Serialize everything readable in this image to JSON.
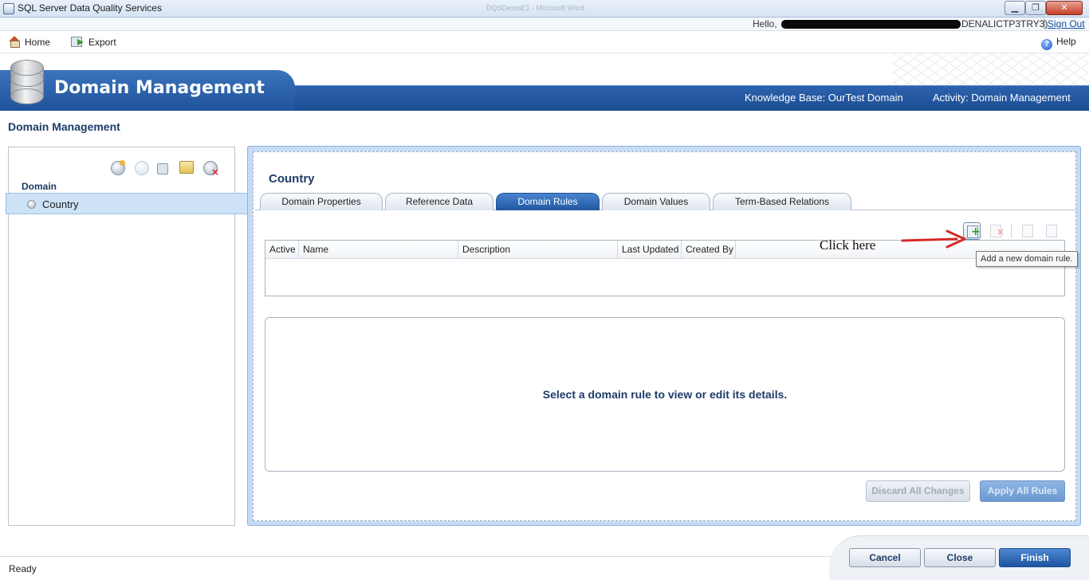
{
  "window": {
    "title": "SQL Server Data Quality Services",
    "faint_title": "DQSDemoE1 - Microsoft Word",
    "minimize_glyph": "▁",
    "maximize_glyph": "❐",
    "close_glyph": "✕"
  },
  "userbar": {
    "hello": "Hello,",
    "user_suffix": "DENALICTP3TRY3)",
    "separator": "|",
    "sign_out": "Sign Out"
  },
  "menu": {
    "home": "Home",
    "export": "Export",
    "help": "Help",
    "help_glyph": "?"
  },
  "banner": {
    "title": "Domain Management",
    "knowledge_base": "Knowledge Base: OurTest Domain",
    "activity": "Activity: Domain Management"
  },
  "page": {
    "title": "Domain Management"
  },
  "left_panel": {
    "section_label": "Domain",
    "domains": [
      "Country"
    ]
  },
  "right_panel": {
    "title": "Country",
    "tabs": [
      "Domain Properties",
      "Reference Data",
      "Domain Rules",
      "Domain Values",
      "Term-Based Relations"
    ],
    "active_tab": "Domain Rules",
    "grid_columns": [
      "Active",
      "Name",
      "Description",
      "Last Updated",
      "Created By"
    ],
    "detail_message": "Select a domain rule to view or edit its details.",
    "discard_button": "Discard All Changes",
    "apply_button": "Apply All Rules",
    "annotation": "Click here",
    "tooltip": "Add a new domain rule."
  },
  "footer": {
    "status": "Ready",
    "cancel": "Cancel",
    "close": "Close",
    "finish": "Finish"
  },
  "colors": {
    "banner": "#1b4c91",
    "accent": "#1f56a0",
    "heading": "#1d3c68",
    "annotation_arrow": "#d42a2a"
  }
}
